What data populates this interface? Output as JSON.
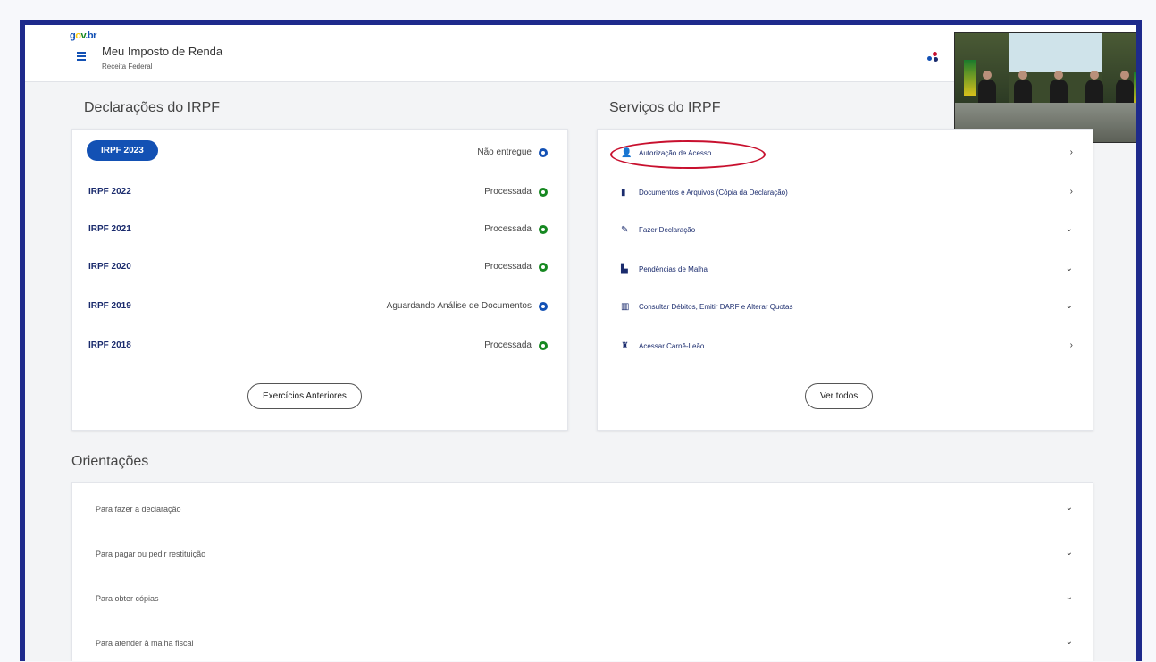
{
  "header": {
    "logo_parts": [
      "g",
      "o",
      "v",
      ".",
      "b",
      "r"
    ],
    "logo_text": "gov.br",
    "title": "Meu Imposto de Renda",
    "subtitle": "Receita Federal",
    "profile_dot_colors": [
      "#c8102e",
      "#1351b4",
      "#168821"
    ]
  },
  "declaracoes": {
    "title": "Declarações do IRPF",
    "rows": [
      {
        "year": "IRPF 2023",
        "status": "Não entregue",
        "status_color": "#1351b4",
        "selected": true
      },
      {
        "year": "IRPF 2022",
        "status": "Processada",
        "status_color": "#168821",
        "selected": false
      },
      {
        "year": "IRPF 2021",
        "status": "Processada",
        "status_color": "#168821",
        "selected": false
      },
      {
        "year": "IRPF 2020",
        "status": "Processada",
        "status_color": "#168821",
        "selected": false
      },
      {
        "year": "IRPF 2019",
        "status": "Aguardando Análise de Documentos",
        "status_color": "#1351b4",
        "selected": false
      },
      {
        "year": "IRPF 2018",
        "status": "Processada",
        "status_color": "#168821",
        "selected": false
      }
    ],
    "button_label": "Exercícios Anteriores"
  },
  "servicos": {
    "title": "Serviços do IRPF",
    "items": [
      {
        "label": "Autorização de Acesso",
        "icon": "user-key-icon",
        "glyph": "👤",
        "chevron": "›",
        "highlighted": true
      },
      {
        "label": "Documentos e Arquivos (Cópia da Declaração)",
        "icon": "document-icon",
        "glyph": "▮",
        "chevron": "›",
        "highlighted": false
      },
      {
        "label": "Fazer Declaração",
        "icon": "edit-icon",
        "glyph": "✎",
        "chevron": "⌄",
        "highlighted": false
      },
      {
        "label": "Pendências de Malha",
        "icon": "chart-icon",
        "glyph": "▙",
        "chevron": "⌄",
        "highlighted": false
      },
      {
        "label": "Consultar Débitos, Emitir DARF e Alterar Quotas",
        "icon": "barcode-icon",
        "glyph": "▥",
        "chevron": "⌄",
        "highlighted": false
      },
      {
        "label": "Acessar Carnê-Leão",
        "icon": "lion-icon",
        "glyph": "♜",
        "chevron": "›",
        "highlighted": false
      }
    ],
    "button_label": "Ver todos"
  },
  "orientacoes": {
    "title": "Orientações",
    "items": [
      {
        "label": "Para fazer a declaração"
      },
      {
        "label": "Para pagar ou pedir restituição"
      },
      {
        "label": "Para obter cópias"
      },
      {
        "label": "Para atender à malha fiscal"
      }
    ],
    "chevron": "⌄"
  },
  "colors": {
    "frame_border": "#1e2a8c",
    "primary_blue": "#1351b4",
    "highlight_red": "#c8102e",
    "success_green": "#168821"
  }
}
